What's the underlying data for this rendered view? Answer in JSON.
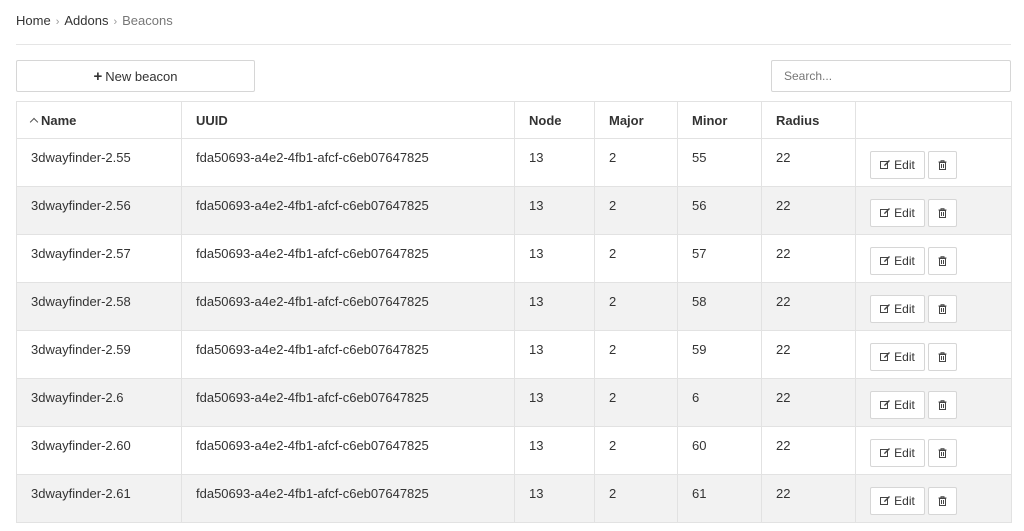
{
  "breadcrumb": {
    "home": "Home",
    "addons": "Addons",
    "current": "Beacons",
    "separator": "›"
  },
  "toolbar": {
    "new_label": "New beacon",
    "search_placeholder": "Search..."
  },
  "table": {
    "columns": [
      "Name",
      "UUID",
      "Node",
      "Major",
      "Minor",
      "Radius",
      ""
    ],
    "sort_column": "Name",
    "sort_direction": "ascending",
    "edit_label": "Edit",
    "edit_icon": "edit-icon",
    "delete_icon": "trash-icon",
    "rows": [
      {
        "name": "3dwayfinder-2.55",
        "uuid": "fda50693-a4e2-4fb1-afcf-c6eb07647825",
        "node": "13",
        "major": "2",
        "minor": "55",
        "radius": "22"
      },
      {
        "name": "3dwayfinder-2.56",
        "uuid": "fda50693-a4e2-4fb1-afcf-c6eb07647825",
        "node": "13",
        "major": "2",
        "minor": "56",
        "radius": "22"
      },
      {
        "name": "3dwayfinder-2.57",
        "uuid": "fda50693-a4e2-4fb1-afcf-c6eb07647825",
        "node": "13",
        "major": "2",
        "minor": "57",
        "radius": "22"
      },
      {
        "name": "3dwayfinder-2.58",
        "uuid": "fda50693-a4e2-4fb1-afcf-c6eb07647825",
        "node": "13",
        "major": "2",
        "minor": "58",
        "radius": "22"
      },
      {
        "name": "3dwayfinder-2.59",
        "uuid": "fda50693-a4e2-4fb1-afcf-c6eb07647825",
        "node": "13",
        "major": "2",
        "minor": "59",
        "radius": "22"
      },
      {
        "name": "3dwayfinder-2.6",
        "uuid": "fda50693-a4e2-4fb1-afcf-c6eb07647825",
        "node": "13",
        "major": "2",
        "minor": "6",
        "radius": "22"
      },
      {
        "name": "3dwayfinder-2.60",
        "uuid": "fda50693-a4e2-4fb1-afcf-c6eb07647825",
        "node": "13",
        "major": "2",
        "minor": "60",
        "radius": "22"
      },
      {
        "name": "3dwayfinder-2.61",
        "uuid": "fda50693-a4e2-4fb1-afcf-c6eb07647825",
        "node": "13",
        "major": "2",
        "minor": "61",
        "radius": "22"
      }
    ]
  }
}
